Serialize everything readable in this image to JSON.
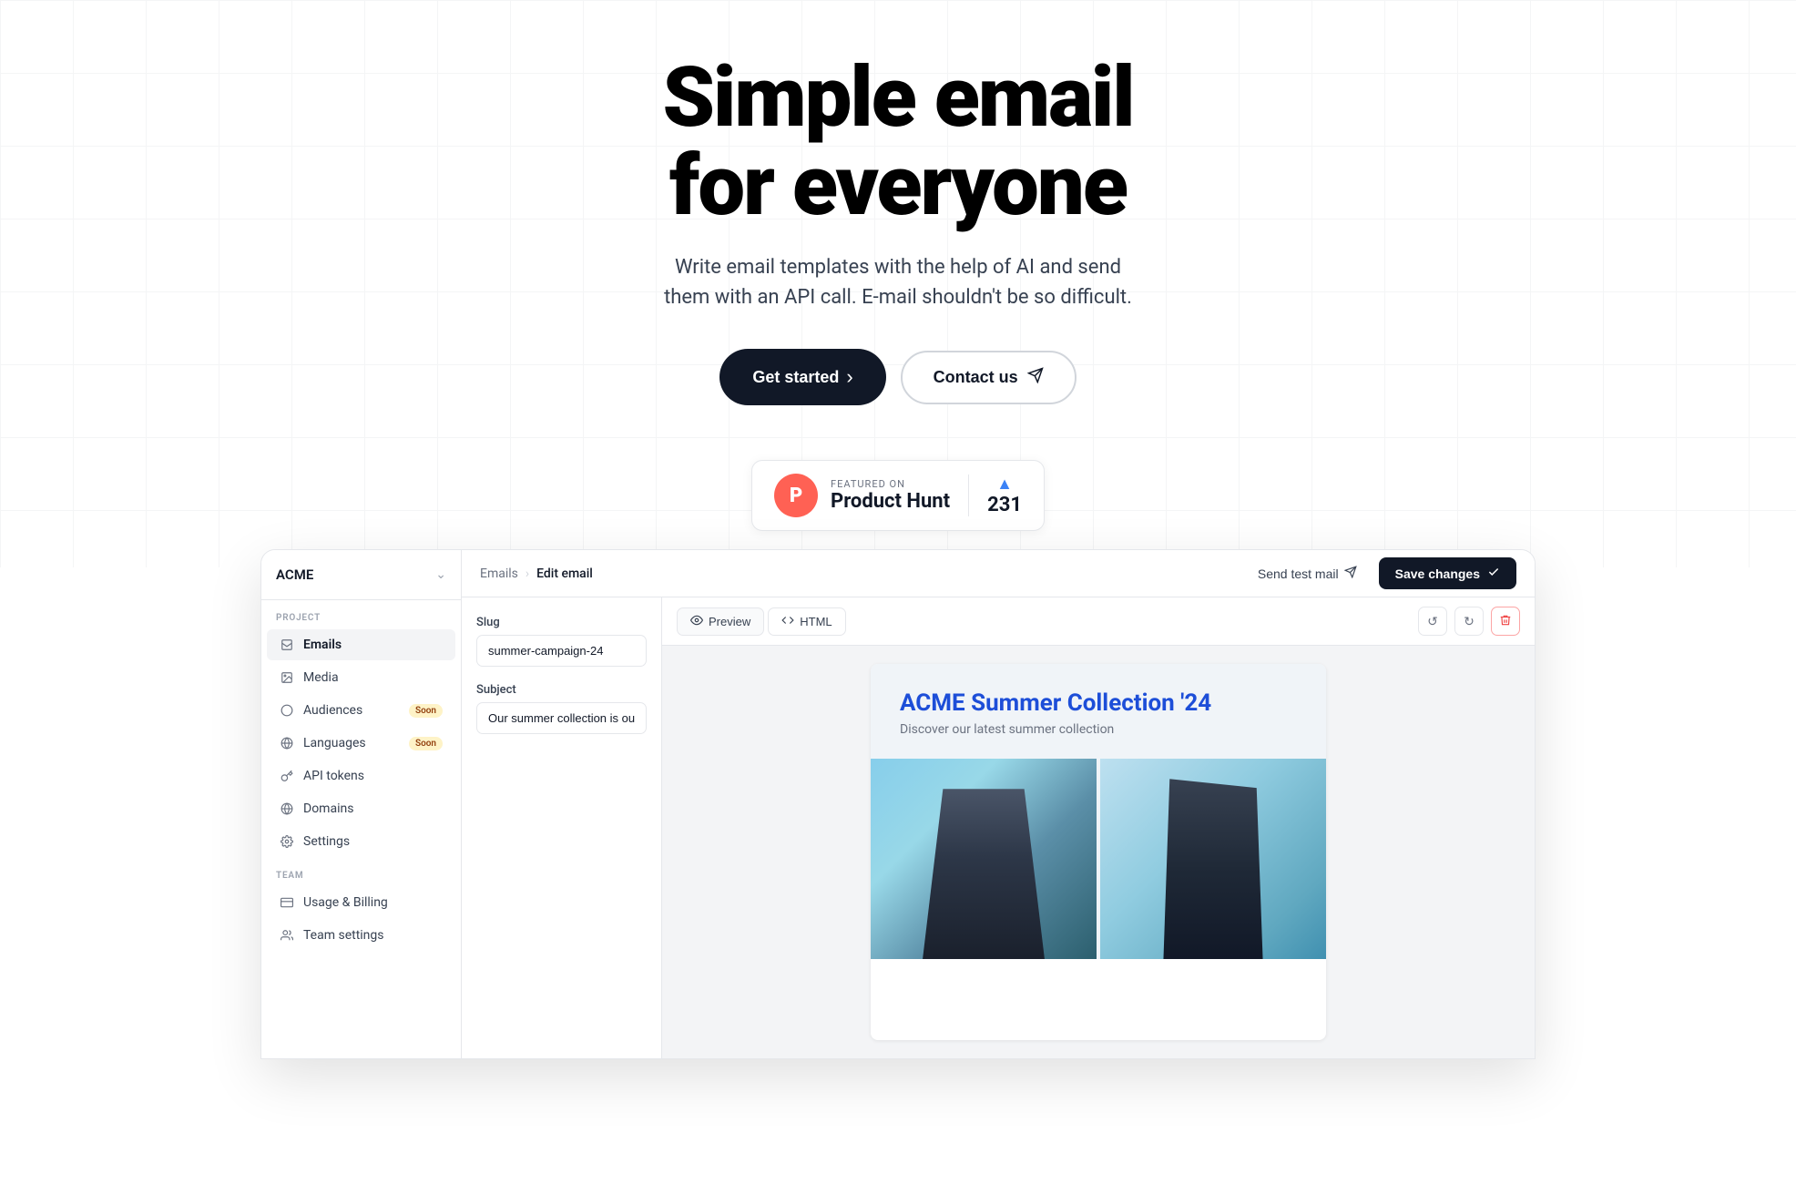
{
  "hero": {
    "title_line1": "Simple email",
    "title_line2": "for everyone",
    "subtitle": "Write email templates with the help of AI and send them with an API call. E-mail shouldn't be so difficult.",
    "btn_primary": "Get started",
    "btn_secondary": "Contact us"
  },
  "product_hunt": {
    "featured_label": "FEATURED ON",
    "name": "Product Hunt",
    "votes": "231"
  },
  "app": {
    "brand": "ACME",
    "breadcrumb_parent": "Emails",
    "breadcrumb_current": "Edit email",
    "send_test_label": "Send test mail",
    "save_changes_label": "Save changes",
    "sidebar": {
      "project_label": "PROJECT",
      "team_label": "TEAM",
      "items": [
        {
          "label": "Emails",
          "icon": "emails-icon",
          "active": true
        },
        {
          "label": "Media",
          "icon": "media-icon",
          "active": false
        },
        {
          "label": "Audiences",
          "icon": "audiences-icon",
          "active": false,
          "badge": "Soon"
        },
        {
          "label": "Languages",
          "icon": "languages-icon",
          "active": false,
          "badge": "Soon"
        },
        {
          "label": "API tokens",
          "icon": "api-icon",
          "active": false
        },
        {
          "label": "Domains",
          "icon": "domains-icon",
          "active": false
        },
        {
          "label": "Settings",
          "icon": "settings-icon",
          "active": false
        }
      ],
      "team_items": [
        {
          "label": "Usage & Billing",
          "icon": "billing-icon"
        },
        {
          "label": "Team settings",
          "icon": "team-icon"
        }
      ]
    },
    "editor": {
      "slug_label": "Slug",
      "slug_value": "summer-campaign-24",
      "subject_label": "Subject",
      "subject_value": "Our summer collection is out now!",
      "tab_preview": "Preview",
      "tab_html": "HTML"
    },
    "email_preview": {
      "title": "ACME Summer Collection '24",
      "subtitle": "Discover our latest summer collection"
    }
  }
}
